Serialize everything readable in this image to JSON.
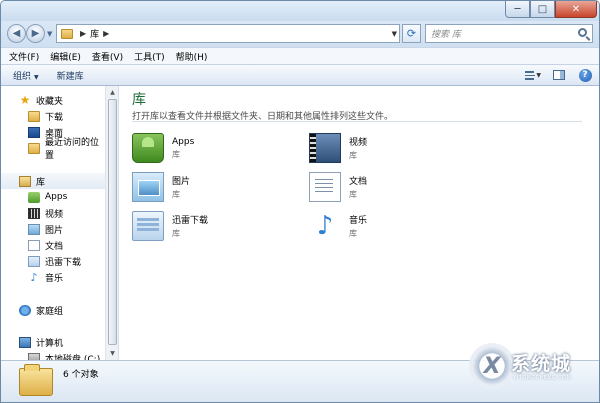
{
  "window": {
    "address": {
      "path_segment": "库"
    },
    "search": {
      "placeholder": "搜索 库"
    },
    "caption": {
      "minimize": "─",
      "maximize": "□",
      "close": "✕"
    }
  },
  "menu": {
    "items": [
      "文件(F)",
      "编辑(E)",
      "查看(V)",
      "工具(T)",
      "帮助(H)"
    ]
  },
  "toolbar": {
    "organize": "组织",
    "new_library": "新建库",
    "help": "?"
  },
  "nav": {
    "favorites_header": "收藏夹",
    "favorites": [
      "下载",
      "桌面",
      "最近访问的位置"
    ],
    "libraries_header": "库",
    "libraries": [
      "Apps",
      "视频",
      "图片",
      "文档",
      "迅雷下载",
      "音乐"
    ],
    "homegroup": "家庭组",
    "computer": "计算机",
    "local_disk": "本地磁盘 (C:)"
  },
  "content": {
    "title": "库",
    "subtitle": "打开库以查看文件并根据文件夹、日期和其他属性排列这些文件。",
    "tiles": [
      {
        "name": "Apps",
        "type": "库",
        "icon": "apps-library-icon"
      },
      {
        "name": "视频",
        "type": "库",
        "icon": "videos-library-icon"
      },
      {
        "name": "图片",
        "type": "库",
        "icon": "pictures-library-icon"
      },
      {
        "name": "文档",
        "type": "库",
        "icon": "documents-library-icon"
      },
      {
        "name": "迅雷下载",
        "type": "库",
        "icon": "xunlei-downloads-library-icon"
      },
      {
        "name": "音乐",
        "type": "库",
        "icon": "music-library-icon"
      }
    ]
  },
  "status": {
    "item_count": "6 个对象"
  },
  "watermark": {
    "logo_letter": "X",
    "text": "系统城",
    "sub": "XITONGCHENG.COM"
  }
}
